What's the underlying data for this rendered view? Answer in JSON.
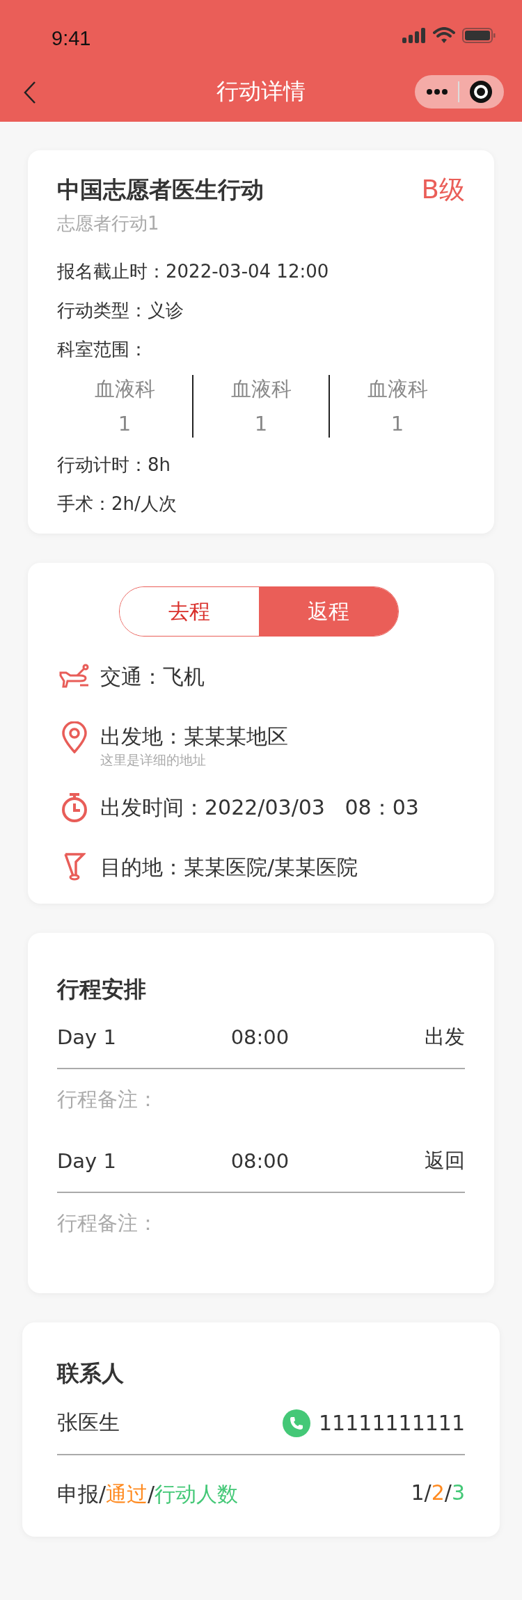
{
  "status_bar": {
    "time": "9:41"
  },
  "nav": {
    "title": "行动详情"
  },
  "action": {
    "title": "中国志愿者医生行动",
    "level": "B级",
    "subtitle": "志愿者行动1",
    "fields": [
      {
        "label": "报名截止时：",
        "value": "2022-03-04 12:00"
      },
      {
        "label": "行动类型：",
        "value": "义诊"
      }
    ],
    "departments_label": "科室范围：",
    "departments": [
      {
        "name": "血液科",
        "count": "1"
      },
      {
        "name": "血液科",
        "count": "1"
      },
      {
        "name": "血液科",
        "count": "1"
      }
    ],
    "extra_fields": [
      {
        "label": "行动计时：",
        "value": "8h"
      },
      {
        "label": "手术：",
        "value": "2h/人次"
      }
    ]
  },
  "trip": {
    "tabs": [
      {
        "label": "去程",
        "selected": false
      },
      {
        "label": "返程",
        "selected": true
      }
    ],
    "rows": [
      {
        "kind": "transport",
        "label": "交通：",
        "value": "飞机"
      },
      {
        "kind": "origin",
        "label": "出发地：",
        "value": "某某某地区",
        "detail": "这里是详细的地址"
      },
      {
        "kind": "time",
        "label": "出发时间：",
        "value": "2022/03/03   08：03"
      },
      {
        "kind": "destination",
        "label": "目的地：",
        "value": "某某医院/某某医院"
      }
    ]
  },
  "schedule": {
    "title": "行程安排",
    "items": [
      {
        "day": "Day 1",
        "time": "08:00",
        "action": "出发",
        "note_label": "行程备注："
      },
      {
        "day": "Day 1",
        "time": "08:00",
        "action": "返回",
        "note_label": "行程备注："
      }
    ]
  },
  "contact": {
    "title": "联系人",
    "name": "张医生",
    "phone": "11111111111",
    "stats_label": [
      {
        "text": "申报",
        "color": "#333333"
      },
      {
        "text": "/",
        "color": "#333333"
      },
      {
        "text": "通过",
        "color": "#ff8a1f"
      },
      {
        "text": "/",
        "color": "#333333"
      },
      {
        "text": "行动人数",
        "color": "#44c877"
      }
    ],
    "stats_value": [
      {
        "text": "1",
        "color": "#333333"
      },
      {
        "text": "/",
        "color": "#333333"
      },
      {
        "text": "2",
        "color": "#ff8a1f"
      },
      {
        "text": "/",
        "color": "#333333"
      },
      {
        "text": "3",
        "color": "#44c877"
      }
    ]
  }
}
